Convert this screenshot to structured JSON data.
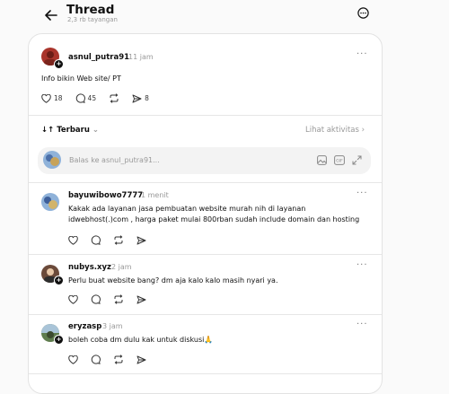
{
  "header": {
    "title": "Thread",
    "views": "2,3 rb tayangan"
  },
  "post": {
    "username": "asnul_putra91",
    "time": "11 jam",
    "text": "Info bikin Web site/ PT",
    "likes": "18",
    "comments": "45",
    "shares": "8"
  },
  "sort": {
    "label": "Terbaru",
    "activity": "Lihat aktivitas"
  },
  "reply": {
    "placeholder": "Balas ke asnul_putra91..."
  },
  "comments": [
    {
      "username": "bayuwibowo7777",
      "time": "1 menit",
      "line1": "Kakak ada layanan jasa pembuatan website murah nih di layanan",
      "line2": "idwebhost(.)com , harga paket mulai 800rban sudah include domain dan hosting"
    },
    {
      "username": "nubys.xyz",
      "time": "2 jam",
      "line1": "Perlu buat website bang? dm aja kalo kalo masih nyari ya.",
      "line2": ""
    },
    {
      "username": "eryzasp",
      "time": "3 jam",
      "line1": "boleh coba dm dulu kak untuk diskusi🙏",
      "line2": ""
    }
  ],
  "colors": {
    "text": "#101010",
    "muted": "#999999",
    "border": "#e3e3e3",
    "accent": "#2f7d3a"
  }
}
